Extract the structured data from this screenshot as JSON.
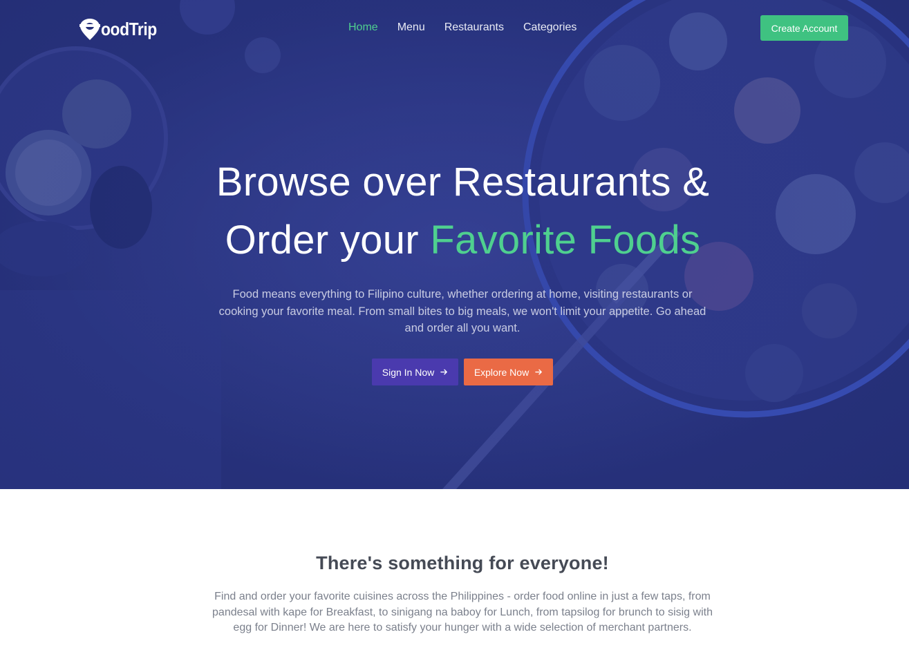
{
  "brand": {
    "name": "oodTrip"
  },
  "nav": {
    "items": [
      {
        "label": "Home",
        "active": true
      },
      {
        "label": "Menu",
        "active": false
      },
      {
        "label": "Restaurants",
        "active": false
      },
      {
        "label": "Categories",
        "active": false
      }
    ],
    "cta_label": "Create Account"
  },
  "hero": {
    "headline_line1": "Browse over Restaurants &",
    "headline_line2_prefix": "Order your ",
    "headline_line2_accent": "Favorite Foods",
    "description": "Food means everything to Filipino culture, whether ordering at home, visiting restaurants or cooking your favorite meal. From small bites to big meals, we won't limit your appetite. Go ahead and order all you want.",
    "primary_button": "Sign In Now",
    "secondary_button": "Explore Now"
  },
  "section": {
    "title": "There's something for everyone!",
    "description": "Find and order your favorite cuisines across the Philippines - order food online in just a few taps, from pandesal with kape for Breakfast, to sinigang na baboy for Lunch, from tapsilog for brunch to sisig with egg for Dinner! We are here to satisfy your hunger with a wide selection of merchant partners."
  },
  "colors": {
    "hero_overlay": "#2b3580",
    "accent_green": "#4fd08f",
    "primary_purple": "#4a3aae",
    "secondary_orange": "#ea6a45",
    "create_button": "#3fc281"
  },
  "icons": {
    "logo": "location-pin-logo-icon",
    "button_arrow": "arrow-right-icon"
  }
}
